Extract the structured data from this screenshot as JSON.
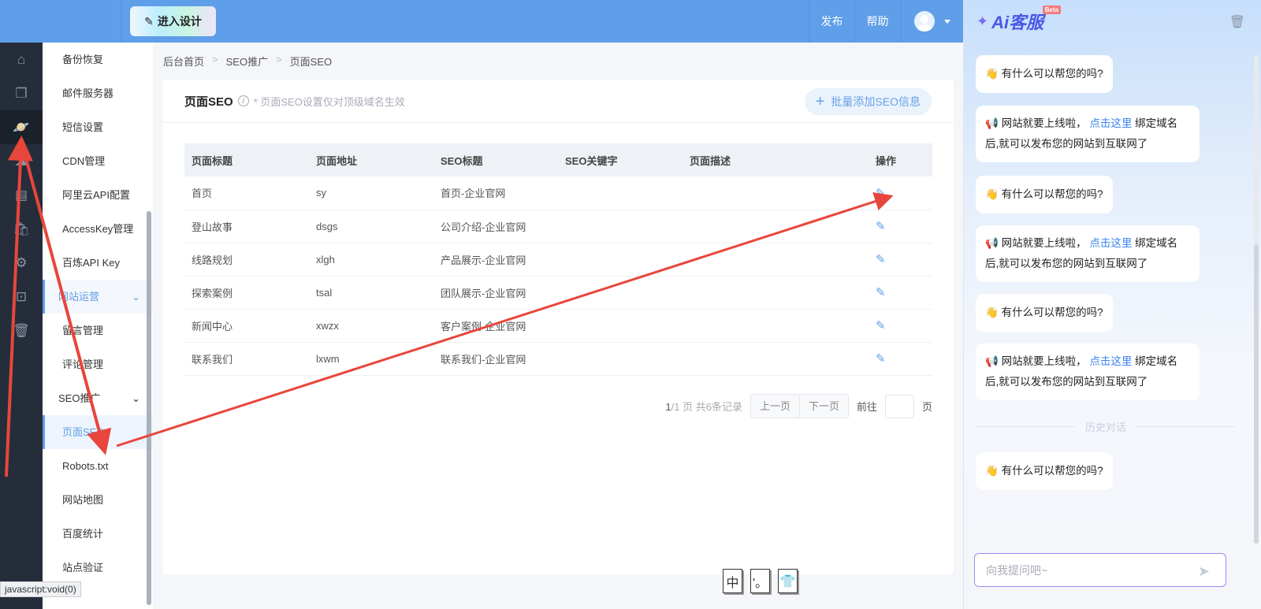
{
  "topbar": {
    "design_button": "进入设计",
    "publish": "发布",
    "help": "帮助"
  },
  "iconbar": {
    "items": [
      "home-icon",
      "pages-icon",
      "planet-icon",
      "cloud-icon",
      "document-icon",
      "bag-icon",
      "gear-icon",
      "terminal-icon",
      "trash-icon"
    ],
    "active": "planet-icon"
  },
  "submenu": {
    "items": [
      {
        "type": "item",
        "label": "备份恢复"
      },
      {
        "type": "item",
        "label": "邮件服务器"
      },
      {
        "type": "item",
        "label": "短信设置"
      },
      {
        "type": "item",
        "label": "CDN管理"
      },
      {
        "type": "item",
        "label": "阿里云API配置"
      },
      {
        "type": "item",
        "label": "AccessKey管理"
      },
      {
        "type": "item",
        "label": "百炼API Key"
      },
      {
        "type": "group",
        "label": "网站运营",
        "highlight": true
      },
      {
        "type": "item",
        "label": "留言管理"
      },
      {
        "type": "item",
        "label": "评论管理"
      },
      {
        "type": "group",
        "label": "SEO推广"
      },
      {
        "type": "item",
        "label": "页面SEO",
        "active": true
      },
      {
        "type": "item",
        "label": "Robots.txt"
      },
      {
        "type": "item",
        "label": "网站地图"
      },
      {
        "type": "item",
        "label": "百度统计"
      },
      {
        "type": "item",
        "label": "站点验证"
      }
    ]
  },
  "breadcrumb": [
    "后台首页",
    "SEO推广",
    "页面SEO"
  ],
  "card": {
    "title": "页面SEO",
    "hint": "* 页面SEO设置仅对顶级域名生效",
    "batch_button": "批量添加SEO信息"
  },
  "table": {
    "headers": [
      "页面标题",
      "页面地址",
      "SEO标题",
      "SEO关键字",
      "页面描述",
      "操作"
    ],
    "rows": [
      [
        "首页",
        "sy",
        "首页-企业官网",
        "",
        ""
      ],
      [
        "登山故事",
        "dsgs",
        "公司介绍-企业官网",
        "",
        ""
      ],
      [
        "线路规划",
        "xlgh",
        "产品展示-企业官网",
        "",
        ""
      ],
      [
        "探索案例",
        "tsal",
        "团队展示-企业官网",
        "",
        ""
      ],
      [
        "新闻中心",
        "xwzx",
        "客户案例-企业官网",
        "",
        ""
      ],
      [
        "联系我们",
        "lxwm",
        "联系我们-企业官网",
        "",
        ""
      ]
    ]
  },
  "pager": {
    "current": "1",
    "total_pages": "/1 页 共6条记录",
    "prev": "上一页",
    "next": "下一页",
    "goto": "前往",
    "page_unit": "页"
  },
  "chat": {
    "title": "Ai客服",
    "beta": "Beta",
    "greeting": "有什么可以帮您的吗?",
    "notice_pre": "网站就要上线啦，",
    "notice_link": "点击这里",
    "notice_post": "绑定域名后,就可以发布您的网站到互联网了",
    "history": "历史对话",
    "input_placeholder": "向我提问吧~"
  },
  "status_bar": "javascript:void(0)",
  "ime": [
    "中",
    "'。",
    "👕"
  ],
  "colors": {
    "accent": "#5f9ee8",
    "annotation_arrow": "#e8463c"
  }
}
